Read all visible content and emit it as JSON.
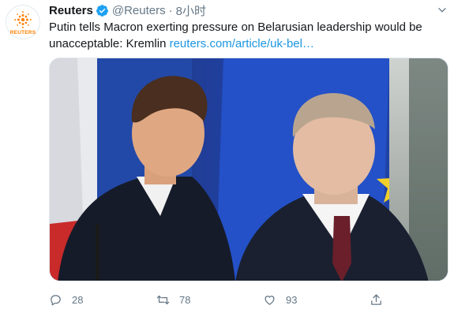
{
  "tweet": {
    "author_name": "Reuters",
    "handle": "@Reuters",
    "separator": "·",
    "time": "8小时",
    "text_line1": "Putin tells Macron exerting pressure on Belarusian leadership would be",
    "text_line2": "unacceptable: Kremlin ",
    "link": "reuters.com/article/uk-bel…",
    "avatar_wordmark": "REUTERS"
  },
  "actions": {
    "reply_count": "28",
    "retweet_count": "78",
    "like_count": "93"
  },
  "icons": {
    "verified": "verified-badge-icon",
    "caret": "chevron-down-icon",
    "reply": "reply-icon",
    "retweet": "retweet-icon",
    "like": "heart-icon",
    "share": "share-icon"
  },
  "colors": {
    "brand_orange": "#ff8000",
    "link_blue": "#1b95e0",
    "muted_gray": "#657786",
    "verified_blue": "#1da1f2"
  }
}
